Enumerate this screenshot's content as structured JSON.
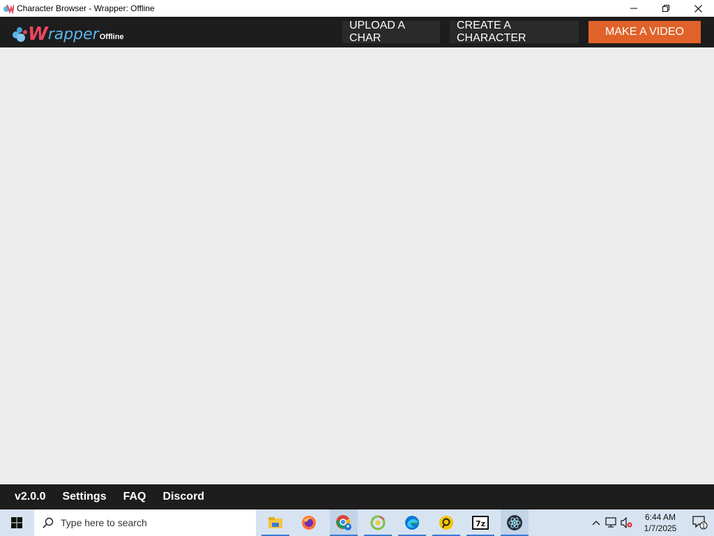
{
  "window": {
    "title": "Character Browser - Wrapper: Offline"
  },
  "header": {
    "logo": {
      "w": "W",
      "rest": "rapper",
      "suffix": "Offline"
    },
    "upload_label": "UPLOAD A CHAR",
    "create_label": "CREATE A CHARACTER",
    "video_label": "MAKE A VIDEO"
  },
  "footer": {
    "version": "v2.0.0",
    "settings": "Settings",
    "faq": "FAQ",
    "discord": "Discord"
  },
  "taskbar": {
    "search_placeholder": "Type here to search",
    "apps": [
      "file-explorer-icon",
      "firefox-icon",
      "chrome-profile-icon",
      "app-green-icon",
      "edge-icon",
      "app-yellow-icon",
      "7zip-icon",
      "electron-icon"
    ],
    "time": "6:44 AM",
    "date": "1/7/2025",
    "notification_count": "1"
  },
  "colors": {
    "appbar_bg": "#1d1d1d",
    "accent_orange": "#e0622a",
    "content_bg": "#ededed",
    "logo_red": "#e8465f",
    "logo_blue": "#5ab4e8"
  }
}
